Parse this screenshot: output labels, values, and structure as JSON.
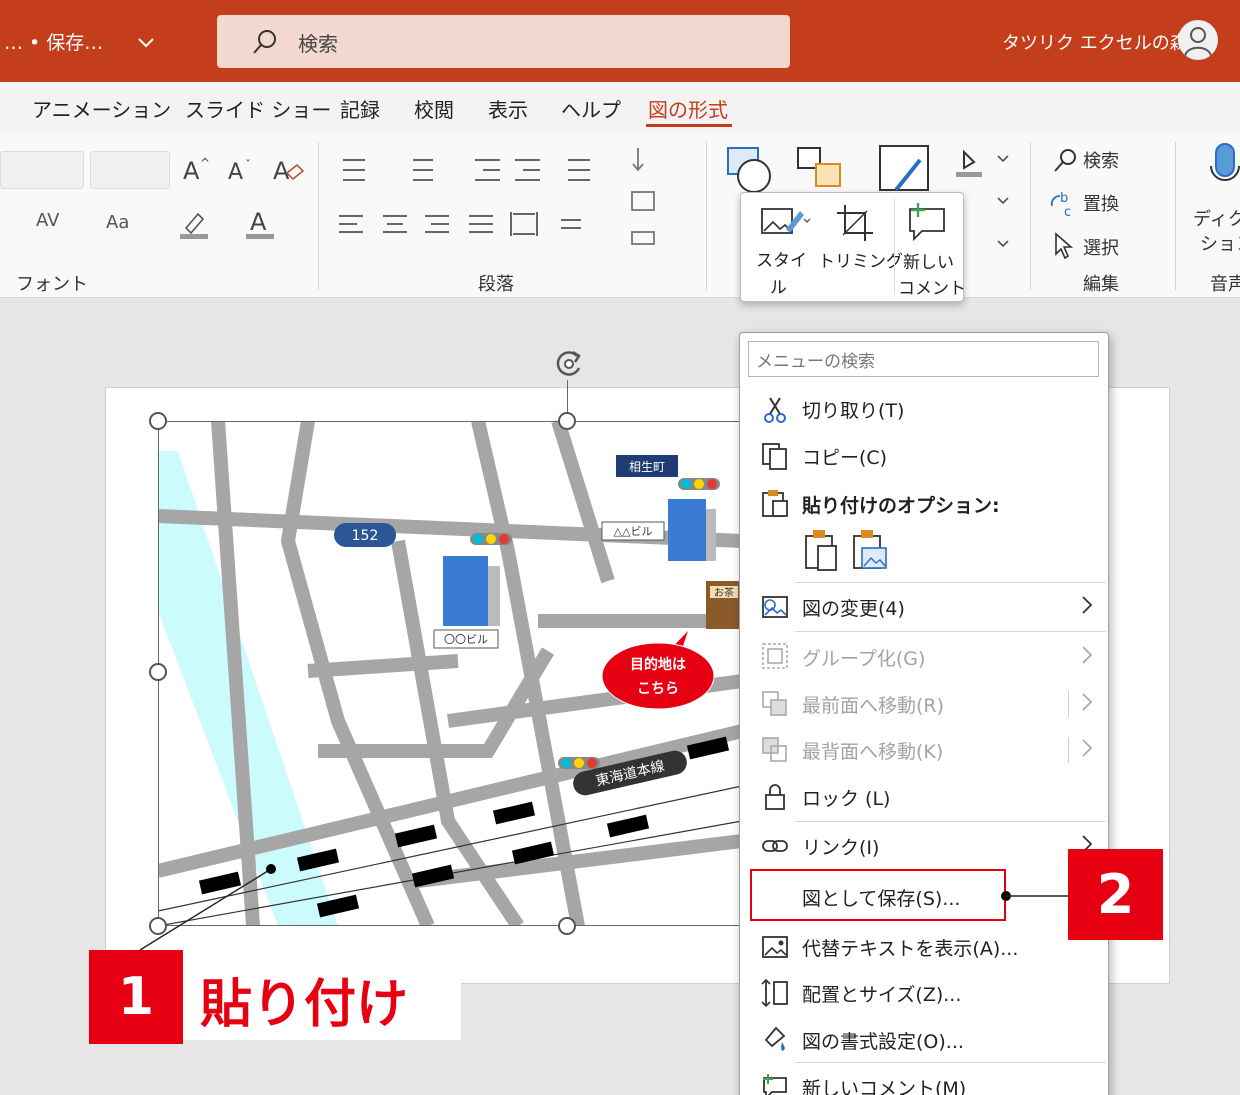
{
  "titlebar": {
    "doc_title": "… • 保存…",
    "search_placeholder": "検索",
    "user_name": "タツリク エクセルの森"
  },
  "tabs": [
    "アニメーション",
    "スライド ショー",
    "記録",
    "校閲",
    "表示",
    "ヘルプ",
    "図の形式"
  ],
  "ribbon": {
    "groups": {
      "font": "フォント",
      "paragraph": "段落",
      "editing": "編集",
      "voice": "音声"
    },
    "font_buttons": {
      "grow": "A^",
      "shrink": "Aˇ",
      "spacing": "AV",
      "case": "Aa"
    },
    "editing": {
      "find": "検索",
      "replace": "置換",
      "select": "選択"
    },
    "dictate": "ディクテーション",
    "dictate_cut1": "ディク",
    "dictate_cut2": "ション",
    "voice_cut": "音声"
  },
  "mini_toolbar": {
    "style": "スタイル",
    "style_l1": "スタイ",
    "style_l2": "ル",
    "trim": "トリミング",
    "new_comment_l1": "新しい",
    "new_comment_l2": "コメント"
  },
  "context_menu": {
    "search_placeholder": "メニューの検索",
    "items": [
      {
        "label": "切り取り(T)",
        "icon": "scissors-icon",
        "enabled": true
      },
      {
        "label": "コピー(C)",
        "icon": "copy-icon",
        "enabled": true
      },
      {
        "label": "貼り付けのオプション:",
        "icon": "paste-icon",
        "enabled": true,
        "bold": true
      },
      {
        "label": "図の変更(4)",
        "icon": "change-picture-icon",
        "enabled": true,
        "submenu": true
      },
      {
        "label": "グループ化(G)",
        "icon": "group-icon",
        "enabled": false,
        "submenu": true
      },
      {
        "label": "最前面へ移動(R)",
        "icon": "bring-front-icon",
        "enabled": false,
        "submenu": true
      },
      {
        "label": "最背面へ移動(K)",
        "icon": "send-back-icon",
        "enabled": false,
        "submenu": true
      },
      {
        "label": "ロック (L)",
        "icon": "lock-icon",
        "enabled": true
      },
      {
        "label": "リンク(I)",
        "icon": "link-icon",
        "enabled": true,
        "submenu": true
      },
      {
        "label": "図として保存(S)...",
        "icon": "",
        "enabled": true,
        "highlighted": true
      },
      {
        "label": "代替テキストを表示(A)...",
        "icon": "alt-text-icon",
        "enabled": true
      },
      {
        "label": "配置とサイズ(Z)...",
        "icon": "size-icon",
        "enabled": true
      },
      {
        "label": "図の書式設定(O)...",
        "icon": "format-picture-icon",
        "enabled": true
      },
      {
        "label": "新しいコメント(M)",
        "icon": "comment-icon",
        "enabled": true
      }
    ]
  },
  "map": {
    "route": "152",
    "station": "相生町",
    "building_a": "△△ビル",
    "building_b": "〇〇ビル",
    "destination_l1": "目的地は",
    "destination_l2": "こちら",
    "railway": "東海道本線",
    "shop_sign": "お茶"
  },
  "annotations": {
    "one_num": "1",
    "one_text": "貼り付け",
    "two_num": "2"
  },
  "colors": {
    "accent": "#c43e1c",
    "callout": "#e60012",
    "river": "#ccfbfd",
    "road": "#a6a6a6"
  }
}
